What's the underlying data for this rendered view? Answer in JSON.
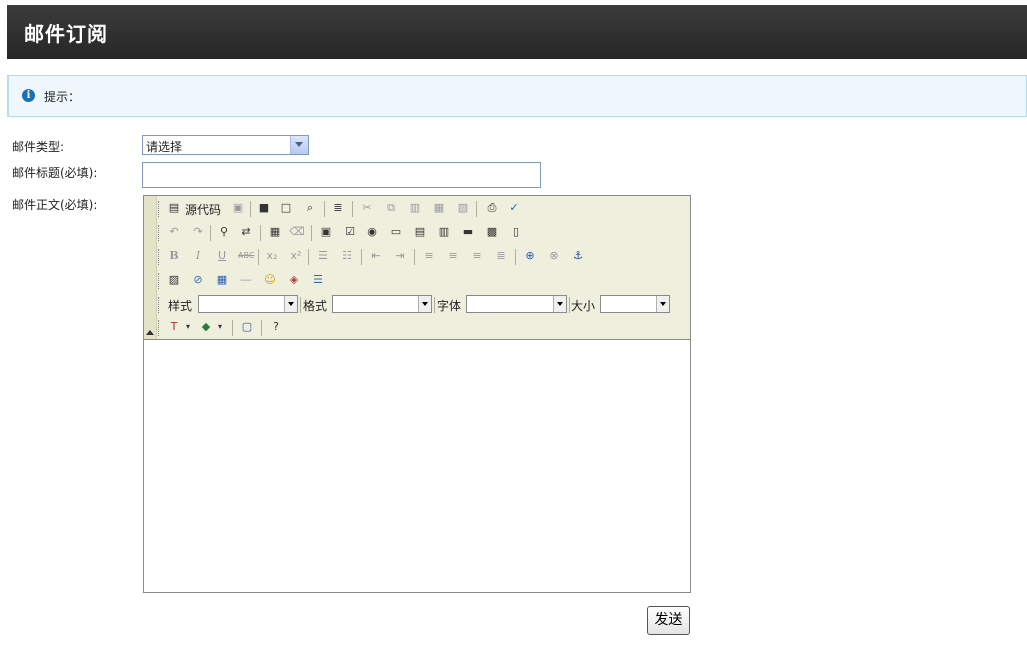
{
  "header": {
    "title": "邮件订阅"
  },
  "tip": {
    "text": "提示：",
    "icon": "info-icon"
  },
  "form": {
    "type_label": "邮件类型:",
    "type_selected": "请选择",
    "subject_label": "邮件标题(必填):",
    "subject_value": "",
    "body_label": "邮件正文(必填):"
  },
  "editor": {
    "source_label": "源代码",
    "style_label": "样式",
    "format_label": "格式",
    "font_label": "字体",
    "size_label": "大小",
    "style_value": "",
    "format_value": "",
    "font_value": "",
    "size_value": ""
  },
  "actions": {
    "send_label": "发送"
  },
  "colors": {
    "header_bg": "#2f2f2f",
    "tip_bg": "#eef8fc",
    "toolbar_bg": "#efefde",
    "accent": "#1a6fb5"
  }
}
